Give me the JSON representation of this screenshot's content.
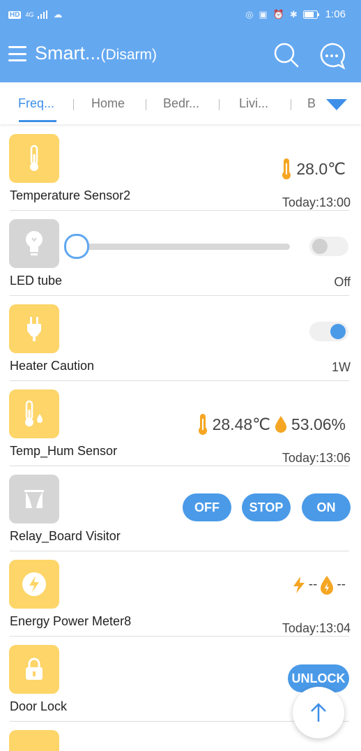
{
  "status_bar": {
    "network": "HD",
    "signal": "4G",
    "time": "1:06"
  },
  "app_bar": {
    "title": "Smart...",
    "subtitle": "(Disarm)"
  },
  "tabs": [
    {
      "label": "Freq...",
      "active": true
    },
    {
      "label": "Home"
    },
    {
      "label": "Bedr..."
    },
    {
      "label": "Livi..."
    },
    {
      "label": "B"
    }
  ],
  "devices": [
    {
      "name": "Temperature Sensor2",
      "value": "28.0℃",
      "time": "Today:13:00"
    },
    {
      "name": "LED tube",
      "state": "Off",
      "brightness": 0,
      "switch_on": false
    },
    {
      "name": "Heater Caution",
      "power": "1W",
      "switch_on": true
    },
    {
      "name": "Temp_Hum Sensor",
      "temp": "28.48℃",
      "humidity": "53.06%",
      "time": "Today:13:06"
    },
    {
      "name": "Relay_Board Visitor",
      "buttons": [
        "OFF",
        "STOP",
        "ON"
      ]
    },
    {
      "name": "Energy Power Meter8",
      "power": "--",
      "energy": "--",
      "time": "Today:13:04"
    },
    {
      "name": "Door Lock",
      "button": "UNLOCK"
    }
  ],
  "colors": {
    "accent": "#64a8f0",
    "tab_active": "#3d8fe8",
    "device_icon": "#fdd568",
    "button": "#4a9ae8",
    "orange": "#f5a623"
  }
}
